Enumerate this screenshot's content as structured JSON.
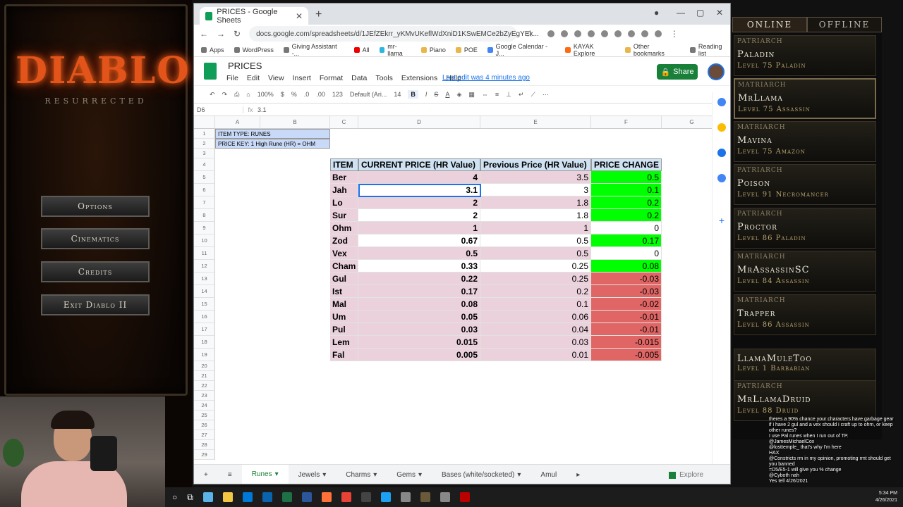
{
  "game": {
    "logo_text": "DIABLO",
    "logo_sub": "RESURRECTED",
    "menu": [
      "Options",
      "Cinematics",
      "Credits",
      "Exit Diablo II"
    ]
  },
  "browser": {
    "tab_title": "PRICES - Google Sheets",
    "url": "docs.google.com/spreadsheets/d/1JEfZEkrr_yKMvUKeflWdXniD1KSwEMCe2bZyEgYEk...",
    "bookmarks": [
      "Apps",
      "WordPress",
      "Giving Assistant -...",
      "All",
      "mr-llama",
      "Piano",
      "POE",
      "Google Calendar - J...",
      "KAYAK Explore",
      "Other bookmarks",
      "Reading list"
    ]
  },
  "sheets": {
    "title": "PRICES",
    "menus": [
      "File",
      "Edit",
      "View",
      "Insert",
      "Format",
      "Data",
      "Tools",
      "Extensions",
      "Help"
    ],
    "last_edit": "Last edit was 4 minutes ago",
    "share": "Share",
    "toolbar": {
      "zoom": "100%",
      "currency": "$",
      "percent": "%",
      "dec0": ".0",
      "dec00": ".00",
      "format": "123",
      "font": "Default (Ari...",
      "size": "14",
      "bold": "B",
      "italic": "I",
      "strike": "S",
      "color": "A"
    },
    "cell_ref": "D6",
    "formula": "3.1",
    "col_headers": [
      "A",
      "B",
      "C",
      "D",
      "E",
      "F",
      "G"
    ],
    "row_numbers": [
      "1",
      "2",
      "3",
      "4",
      "5",
      "6",
      "7",
      "8",
      "9",
      "10",
      "11",
      "12",
      "13",
      "14",
      "15",
      "16",
      "17",
      "18",
      "19",
      "20",
      "21",
      "22",
      "23",
      "24",
      "25",
      "26",
      "27",
      "28",
      "29"
    ],
    "info1": "ITEM TYPE: RUNES",
    "info2": "PRICE KEY: 1 High Rune (HR) = OHM",
    "headers": [
      "ITEM",
      "CURRENT PRICE (HR Value)",
      "Previous Price (HR Value)",
      "PRICE CHANGE"
    ],
    "rows": [
      {
        "item": "Ber",
        "current": "4",
        "previous": "3.5",
        "change": "0.5",
        "dir": "up"
      },
      {
        "item": "Jah",
        "current": "3.1",
        "previous": "3",
        "change": "0.1",
        "dir": "up"
      },
      {
        "item": "Lo",
        "current": "2",
        "previous": "1.8",
        "change": "0.2",
        "dir": "up"
      },
      {
        "item": "Sur",
        "current": "2",
        "previous": "1.8",
        "change": "0.2",
        "dir": "up"
      },
      {
        "item": "Ohm",
        "current": "1",
        "previous": "1",
        "change": "0",
        "dir": "none"
      },
      {
        "item": "Zod",
        "current": "0.67",
        "previous": "0.5",
        "change": "0.17",
        "dir": "up"
      },
      {
        "item": "Vex",
        "current": "0.5",
        "previous": "0.5",
        "change": "0",
        "dir": "none"
      },
      {
        "item": "Cham",
        "current": "0.33",
        "previous": "0.25",
        "change": "0.08",
        "dir": "up"
      },
      {
        "item": "Gul",
        "current": "0.22",
        "previous": "0.25",
        "change": "-0.03",
        "dir": "down"
      },
      {
        "item": "Ist",
        "current": "0.17",
        "previous": "0.2",
        "change": "-0.03",
        "dir": "down"
      },
      {
        "item": "Mal",
        "current": "0.08",
        "previous": "0.1",
        "change": "-0.02",
        "dir": "down"
      },
      {
        "item": "Um",
        "current": "0.05",
        "previous": "0.06",
        "change": "-0.01",
        "dir": "down"
      },
      {
        "item": "Pul",
        "current": "0.03",
        "previous": "0.04",
        "change": "-0.01",
        "dir": "down"
      },
      {
        "item": "Lem",
        "current": "0.015",
        "previous": "0.03",
        "change": "-0.015",
        "dir": "down"
      },
      {
        "item": "Fal",
        "current": "0.005",
        "previous": "0.01",
        "change": "-0.005",
        "dir": "down"
      }
    ],
    "tabs": [
      "Runes",
      "Jewels",
      "Charms",
      "Gems",
      "Bases (white/socketed)",
      "Amul"
    ],
    "explore": "Explore"
  },
  "characters": {
    "tabs": [
      "ONLINE",
      "OFFLINE"
    ],
    "list": [
      {
        "rank": "PATRIARCH",
        "name": "Paladin",
        "level": "Level 75 Paladin"
      },
      {
        "rank": "MATRIARCH",
        "name": "MrLlama",
        "level": "Level 75 Assassin"
      },
      {
        "rank": "MATRIARCH",
        "name": "Mavina",
        "level": "Level 75 Amazon"
      },
      {
        "rank": "PATRIARCH",
        "name": "Poison",
        "level": "Level 91 Necromancer"
      },
      {
        "rank": "PATRIARCH",
        "name": "Proctor",
        "level": "Level 86 Paladin"
      },
      {
        "rank": "MATRIARCH",
        "name": "MrAssassinSC",
        "level": "Level 84 Assassin"
      },
      {
        "rank": "MATRIARCH",
        "name": "Trapper",
        "level": "Level 86 Assassin"
      },
      {
        "rank": "",
        "name": "LlamaMuleToo",
        "level": "Level 1 Barbarian"
      },
      {
        "rank": "PATRIARCH",
        "name": "MrLlamaDruid",
        "level": "Level 88 Druid"
      }
    ]
  },
  "chat": [
    "theres a 90% chance your characters have garbage gear",
    "if i have 2 gul and a vex should i craft up to ohm, or keep other runes?",
    "I use Pal runes when I run out of TP.",
    "@JamesMichaelCox",
    "@losttemple_ that's why I'm here",
    "HAX",
    "@Constricts rm in my opinion, promoting rmt should get you banned",
    "=D5/E5-1 will give you % change",
    "@Cyboth nah",
    "Yes tell 4/26/2021"
  ],
  "clock": {
    "time": "5:34 PM",
    "date": "4/26/2021"
  }
}
